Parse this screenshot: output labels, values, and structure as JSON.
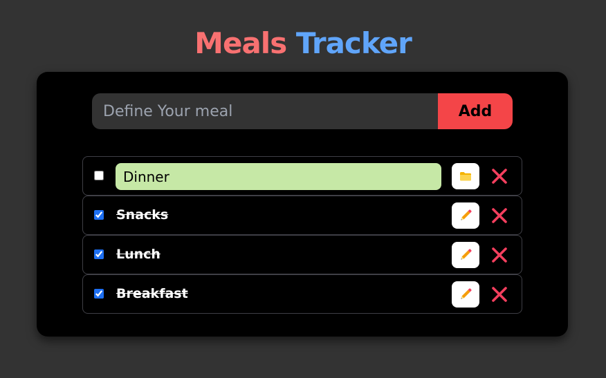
{
  "header": {
    "title_word1": "Meals",
    "title_word2": "Tracker",
    "title_word1_color": "#f87171",
    "title_word2_color": "#60a5fa"
  },
  "add_form": {
    "placeholder": "Define Your meal",
    "value": "",
    "add_label": "Add",
    "accent_color": "#f44548"
  },
  "meals": [
    {
      "name": "Dinner",
      "checked": false,
      "editing": true,
      "action_icon": "folder-icon"
    },
    {
      "name": "Snacks",
      "checked": true,
      "editing": false,
      "action_icon": "pencil-icon"
    },
    {
      "name": "Lunch",
      "checked": true,
      "editing": false,
      "action_icon": "pencil-icon"
    },
    {
      "name": "Breakfast",
      "checked": true,
      "editing": false,
      "action_icon": "pencil-icon"
    }
  ],
  "icons": {
    "delete": "close-icon",
    "delete_color": "#f43f5e",
    "edit_field_color": "#c6e8a6"
  }
}
